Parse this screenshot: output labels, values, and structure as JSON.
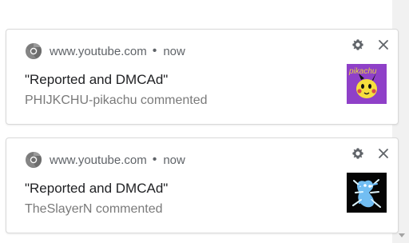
{
  "notifications": [
    {
      "origin": "www.youtube.com",
      "separator": "•",
      "timestamp": "now",
      "message": "\"Reported and DMCAd\"",
      "context": "PHIJKCHU-pikachu commented",
      "thumbnail_icon": "pikachu-thumbnail-icon",
      "thumbnail_text": "pikachu"
    },
    {
      "origin": "www.youtube.com",
      "separator": "•",
      "timestamp": "now",
      "message": "\"Reported and DMCAd\"",
      "context": "TheSlayerN commented",
      "thumbnail_icon": "frog-thumbnail-icon"
    }
  ],
  "icons": {
    "browser": "chrome-icon",
    "settings": "gear-icon",
    "dismiss": "close-icon"
  },
  "colors": {
    "background": "#ffffff",
    "card_border": "#d9d9d9",
    "origin_text": "#5f6368",
    "message_text": "#202124",
    "context_text": "#7a7a7a",
    "rail": "#f1f1f1",
    "pikachu_bg": "#8f40c8",
    "pikachu_yellow": "#f6df3d",
    "frog_bg": "#050505",
    "frog_accent": "#78c8ff"
  }
}
